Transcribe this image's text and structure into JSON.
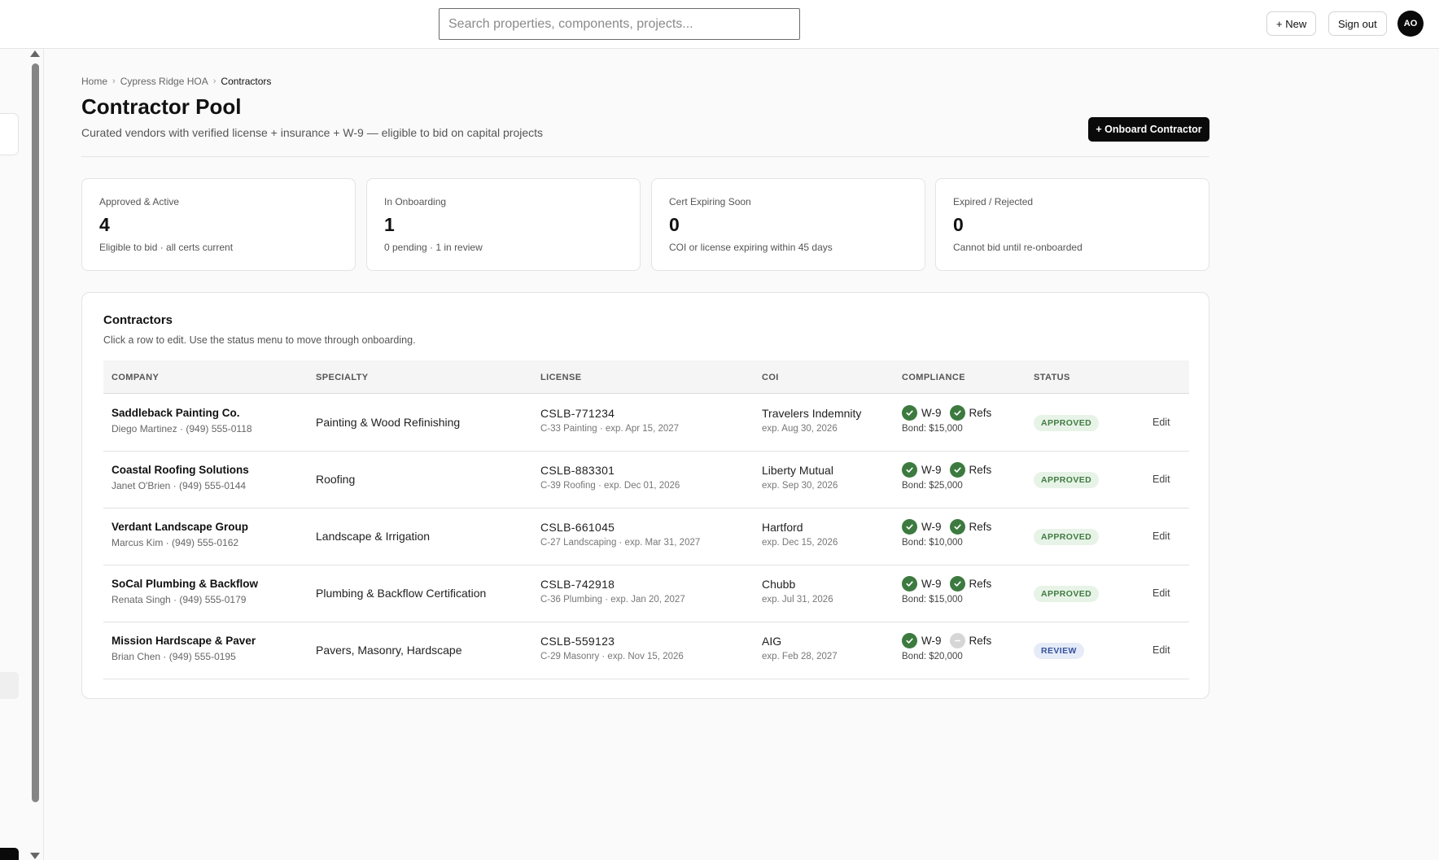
{
  "topbar": {
    "search_placeholder": "Search properties, components, projects...",
    "new_label": "+ New",
    "signout_label": "Sign out",
    "avatar_initials": "AO"
  },
  "breadcrumb": [
    "Home",
    "Cypress Ridge HOA",
    "Contractors"
  ],
  "page": {
    "title": "Contractor Pool",
    "subtitle": "Curated vendors with verified license + insurance + W-9 — eligible to bid on capital projects",
    "onboard_label": "+ Onboard Contractor"
  },
  "stats": [
    {
      "label": "Approved & Active",
      "value": "4",
      "desc": "Eligible to bid · all certs current"
    },
    {
      "label": "In Onboarding",
      "value": "1",
      "desc": "0 pending · 1 in review"
    },
    {
      "label": "Cert Expiring Soon",
      "value": "0",
      "desc": "COI or license expiring within 45 days"
    },
    {
      "label": "Expired / Rejected",
      "value": "0",
      "desc": "Cannot bid until re-onboarded"
    }
  ],
  "contractors_table": {
    "title": "Contractors",
    "description": "Click a row to edit. Use the status menu to move through onboarding.",
    "columns": [
      "COMPANY",
      "SPECIALTY",
      "LICENSE",
      "COI",
      "COMPLIANCE",
      "STATUS"
    ],
    "rows": [
      {
        "company": "Saddleback Painting Co.",
        "contact": "Diego Martinez · (949) 555-0118",
        "specialty": "Painting & Wood Refinishing",
        "license": "CSLB-771234",
        "license_detail": "C-33 Painting · exp. Apr 15, 2027",
        "coi": "Travelers Indemnity",
        "coi_exp": "exp. Aug 30, 2026",
        "w9_label": "W-9",
        "w9_ok": true,
        "refs_label": "Refs",
        "refs_ok": true,
        "bond": "Bond: $15,000",
        "status": "APPROVED",
        "edit": "Edit"
      },
      {
        "company": "Coastal Roofing Solutions",
        "contact": "Janet O'Brien · (949) 555-0144",
        "specialty": "Roofing",
        "license": "CSLB-883301",
        "license_detail": "C-39 Roofing · exp. Dec 01, 2026",
        "coi": "Liberty Mutual",
        "coi_exp": "exp. Sep 30, 2026",
        "w9_label": "W-9",
        "w9_ok": true,
        "refs_label": "Refs",
        "refs_ok": true,
        "bond": "Bond: $25,000",
        "status": "APPROVED",
        "edit": "Edit"
      },
      {
        "company": "Verdant Landscape Group",
        "contact": "Marcus Kim · (949) 555-0162",
        "specialty": "Landscape & Irrigation",
        "license": "CSLB-661045",
        "license_detail": "C-27 Landscaping · exp. Mar 31, 2027",
        "coi": "Hartford",
        "coi_exp": "exp. Dec 15, 2026",
        "w9_label": "W-9",
        "w9_ok": true,
        "refs_label": "Refs",
        "refs_ok": true,
        "bond": "Bond: $10,000",
        "status": "APPROVED",
        "edit": "Edit"
      },
      {
        "company": "SoCal Plumbing & Backflow",
        "contact": "Renata Singh · (949) 555-0179",
        "specialty": "Plumbing & Backflow Certification",
        "license": "CSLB-742918",
        "license_detail": "C-36 Plumbing · exp. Jan 20, 2027",
        "coi": "Chubb",
        "coi_exp": "exp. Jul 31, 2026",
        "w9_label": "W-9",
        "w9_ok": true,
        "refs_label": "Refs",
        "refs_ok": true,
        "bond": "Bond: $15,000",
        "status": "APPROVED",
        "edit": "Edit"
      },
      {
        "company": "Mission Hardscape & Paver",
        "contact": "Brian Chen · (949) 555-0195",
        "specialty": "Pavers, Masonry, Hardscape",
        "license": "CSLB-559123",
        "license_detail": "C-29 Masonry · exp. Nov 15, 2026",
        "coi": "AIG",
        "coi_exp": "exp. Feb 28, 2027",
        "w9_label": "W-9",
        "w9_ok": true,
        "refs_label": "Refs",
        "refs_ok": false,
        "bond": "Bond: $20,000",
        "status": "REVIEW",
        "edit": "Edit"
      }
    ]
  },
  "icons": {
    "check": "check-circle-icon",
    "pending": "minus-circle-icon",
    "breadcrumb_sep": "chevron-right-icon"
  },
  "colors": {
    "approved_bg": "#e8f3e8",
    "approved_text": "#3f7b40",
    "review_bg": "#e6ebf8",
    "review_text": "#34519c",
    "check_green": "#3c7a3f",
    "primary_button": "#0a0a0a"
  }
}
